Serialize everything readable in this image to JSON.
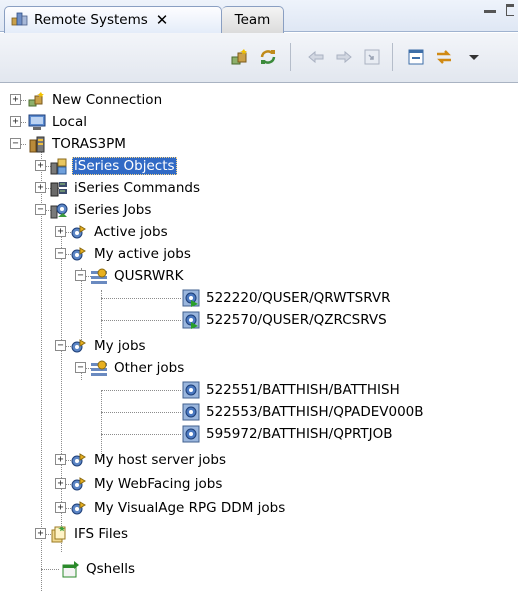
{
  "view": {
    "active_tab": "Remote Systems",
    "active_tab_close": "✕",
    "other_tab": "Team"
  },
  "toolbar": {
    "buttons": [
      "new-connection-icon",
      "refresh-icon",
      "back-arrow-icon",
      "forward-arrow-icon",
      "go-into-icon",
      "collapse-all-icon",
      "link-with-editor-icon",
      "view-menu-icon"
    ]
  },
  "tree": {
    "new_connection": "New Connection",
    "local": "Local",
    "system": "TORAS3PM",
    "iseries_objects": "iSeries Objects",
    "iseries_commands": "iSeries Commands",
    "iseries_jobs": "iSeries Jobs",
    "active_jobs": "Active jobs",
    "my_active_jobs": "My active jobs",
    "qusrwrk": "QUSRWRK",
    "job_1": "522220/QUSER/QRWTSRVR",
    "job_2": "522570/QUSER/QZRCSRVS",
    "my_jobs": "My jobs",
    "other_jobs": "Other jobs",
    "job_3": "522551/BATTHISH/BATTHISH",
    "job_4": "522553/BATTHISH/QPADEV000B",
    "job_5": "595972/BATTHISH/QPRTJOB",
    "my_host_server_jobs": "My host server jobs",
    "my_webfacing_jobs": "My WebFacing jobs",
    "my_visualage_jobs": "My VisualAge RPG DDM jobs",
    "ifs_files": "IFS Files",
    "qshells": "Qshells"
  },
  "colors": {
    "selection": "#316ac5",
    "tab_border": "#8a9fc2"
  }
}
